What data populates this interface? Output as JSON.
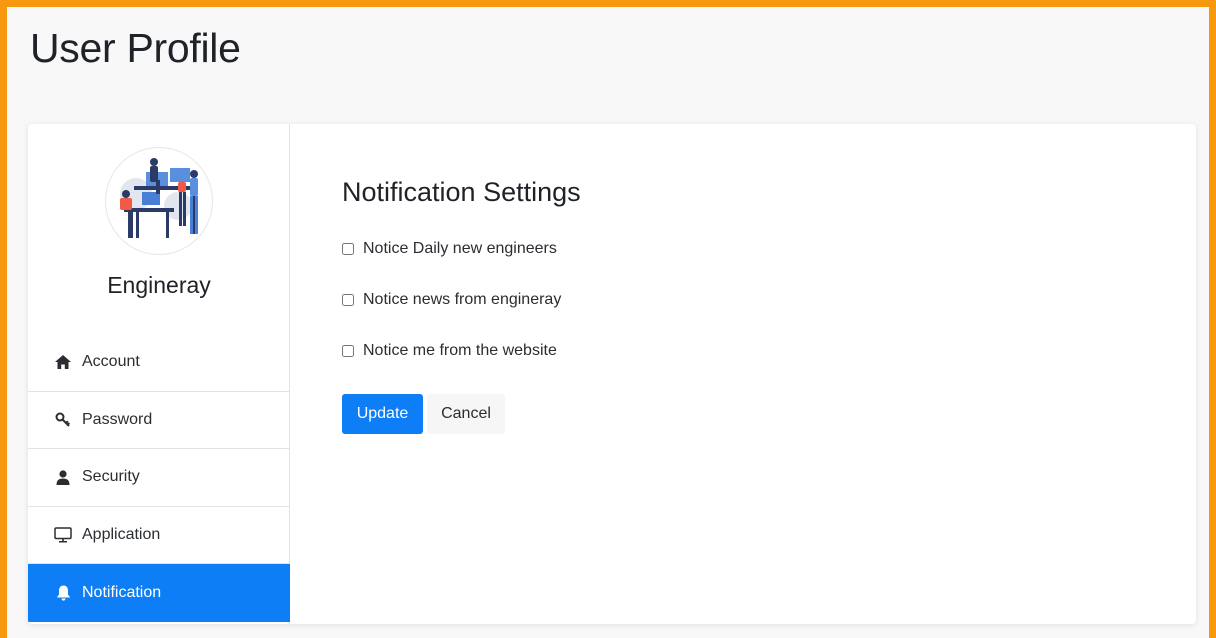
{
  "page": {
    "title": "User Profile"
  },
  "profile": {
    "name": "Engineray"
  },
  "sidebar": {
    "items": [
      {
        "label": "Account",
        "icon": "home-icon"
      },
      {
        "label": "Password",
        "icon": "key-icon"
      },
      {
        "label": "Security",
        "icon": "user-icon"
      },
      {
        "label": "Application",
        "icon": "monitor-icon"
      },
      {
        "label": "Notification",
        "icon": "bell-icon",
        "active": true
      }
    ]
  },
  "main": {
    "title": "Notification Settings",
    "options": [
      {
        "label": "Notice Daily new engineers",
        "checked": false
      },
      {
        "label": "Notice news from engineray",
        "checked": false
      },
      {
        "label": "Notice me from the website",
        "checked": false
      }
    ],
    "update_label": "Update",
    "cancel_label": "Cancel"
  },
  "colors": {
    "accent": "#0d7ef5",
    "frame": "#f7980f"
  }
}
